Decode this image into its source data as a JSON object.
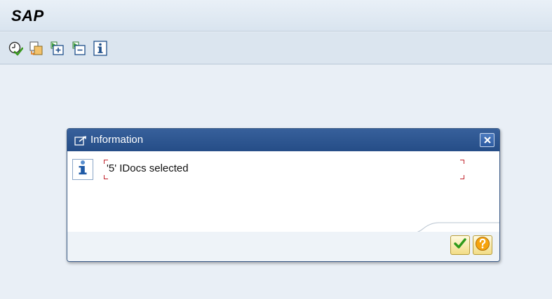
{
  "window": {
    "title": "SAP"
  },
  "toolbar": {
    "buttons": [
      {
        "icon": "execute-clock-icon"
      },
      {
        "icon": "copy-objects-icon"
      },
      {
        "icon": "expand-all-icon"
      },
      {
        "icon": "collapse-all-icon"
      },
      {
        "icon": "information-icon"
      }
    ]
  },
  "dialog": {
    "title": "Information",
    "message": "'5' IDocs selected",
    "buttons": {
      "confirm": {
        "icon": "checkmark-icon"
      },
      "help": {
        "icon": "question-mark-icon"
      }
    }
  },
  "colors": {
    "background": "#e9eff6",
    "dialog_header": "#2a528c",
    "dialog_body": "#ffffff",
    "field_corner_marks": "#c0202a",
    "button_fill": "#f5e3a0"
  }
}
